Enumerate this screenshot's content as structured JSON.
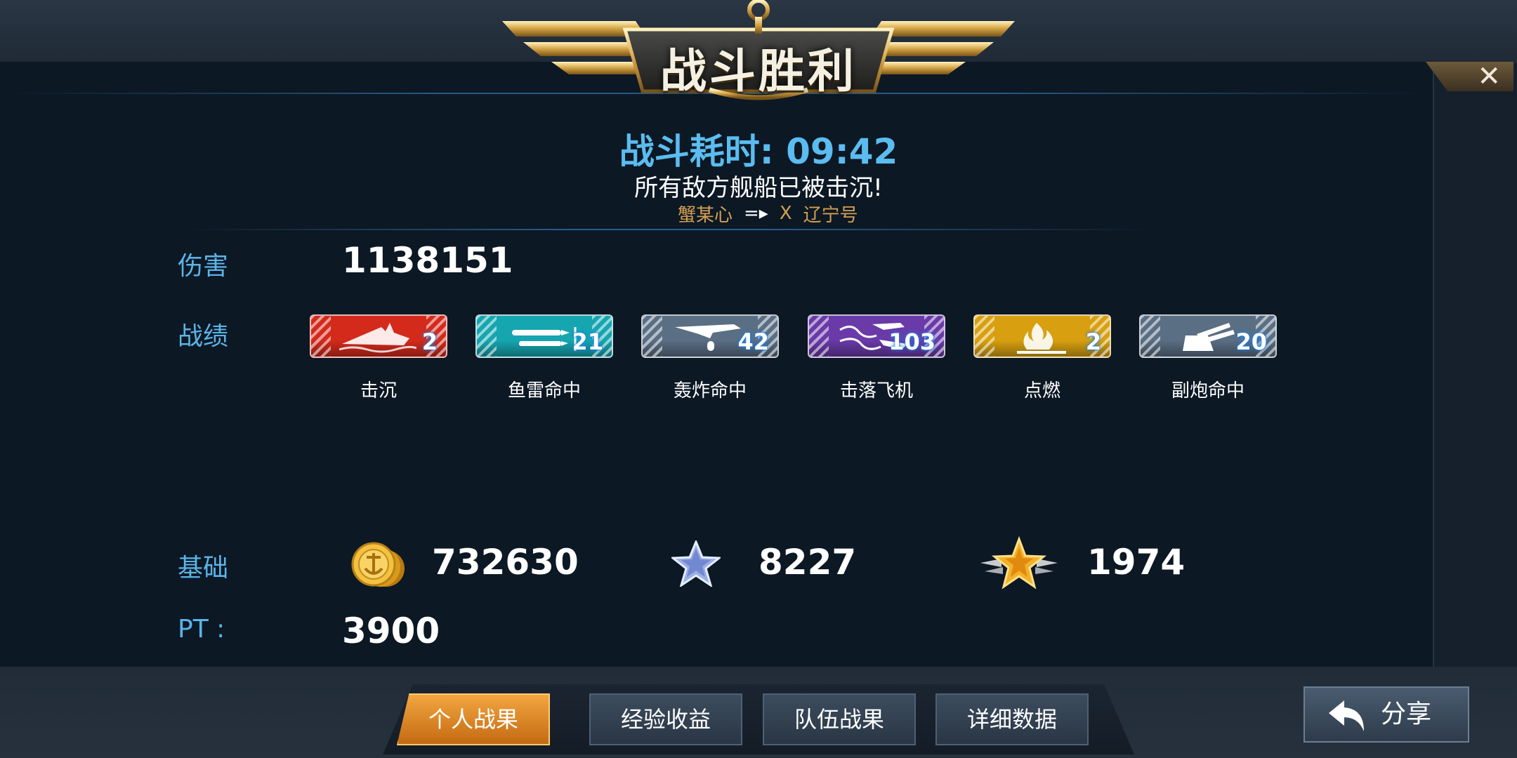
{
  "banner": {
    "title": "战斗胜利"
  },
  "header": {
    "duration": "战斗耗时: 09:42",
    "result_message": "所有敌方舰船已被击沉!",
    "killfeed": {
      "attacker": "蟹某心",
      "arrow": "=▸",
      "separator": "X",
      "target": "辽宁号"
    }
  },
  "close_label": "✕",
  "damage": {
    "label": "伤害",
    "value": "1138151"
  },
  "record": {
    "label": "战绩",
    "items": [
      {
        "count": "2",
        "caption": "击沉",
        "color": "#d42a1c",
        "icon": "ship-sinking-icon"
      },
      {
        "count": "21",
        "caption": "鱼雷命中",
        "color": "#16a6b0",
        "icon": "torpedo-icon"
      },
      {
        "count": "42",
        "caption": "轰炸命中",
        "color": "#5a6e84",
        "icon": "bomber-icon"
      },
      {
        "count": "103",
        "caption": "击落飞机",
        "color": "#6a3aa8",
        "icon": "plane-shot-down-icon"
      },
      {
        "count": "2",
        "caption": "点燃",
        "color": "#d8a010",
        "icon": "fire-icon"
      },
      {
        "count": "20",
        "caption": "副炮命中",
        "color": "#5a6e84",
        "icon": "secondary-gun-icon"
      }
    ]
  },
  "base": {
    "label": "基础",
    "coins": "732630",
    "silver_star": "8227",
    "gold_star": "1974"
  },
  "pt": {
    "label": "PT :",
    "value": "3900"
  },
  "tabs": [
    "个人战果",
    "经验收益",
    "队伍战果",
    "详细数据"
  ],
  "share_label": "分享"
}
